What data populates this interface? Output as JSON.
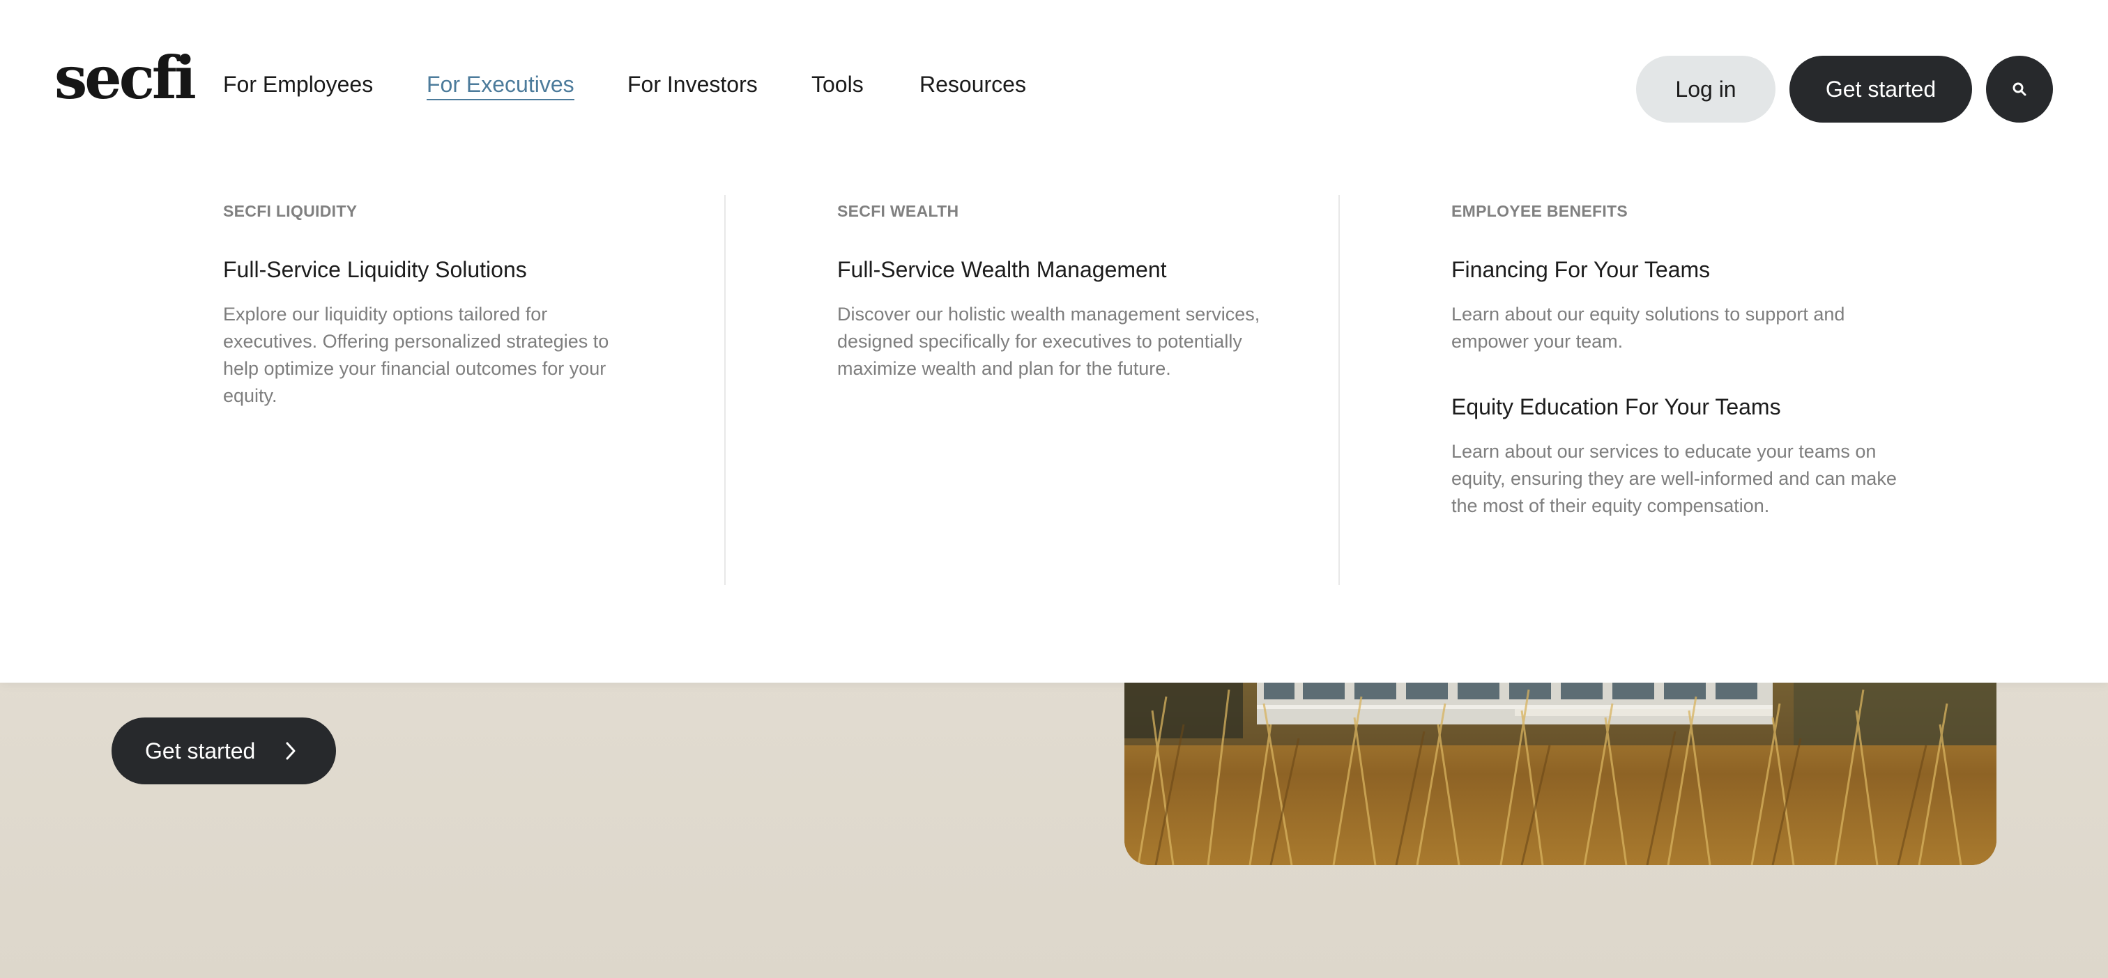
{
  "brand": {
    "logo_text": "secfi"
  },
  "nav": {
    "items": [
      {
        "label": "For Employees",
        "active": false
      },
      {
        "label": "For Executives",
        "active": true
      },
      {
        "label": "For Investors",
        "active": false
      },
      {
        "label": "Tools",
        "active": false
      },
      {
        "label": "Resources",
        "active": false
      }
    ]
  },
  "header_actions": {
    "login_label": "Log in",
    "get_started_label": "Get started",
    "search_icon": "search-icon"
  },
  "mega_menu": {
    "columns": [
      {
        "eyebrow": "SECFI LIQUIDITY",
        "links": [
          {
            "title": "Full-Service Liquidity Solutions",
            "description": "Explore our liquidity options tailored for executives. Offering personalized strategies to help optimize your financial outcomes for your equity."
          }
        ]
      },
      {
        "eyebrow": "SECFI WEALTH",
        "links": [
          {
            "title": "Full-Service Wealth Management",
            "description": "Discover our holistic wealth management services, designed specifically for executives to potentially maximize wealth and plan for the future."
          }
        ]
      },
      {
        "eyebrow": "EMPLOYEE BENEFITS",
        "links": [
          {
            "title": "Financing For Your Teams",
            "description": "Learn about our equity solutions to support and empower your team."
          },
          {
            "title": "Equity Education For Your Teams",
            "description": "Learn about our services to educate your teams on equity, ensuring they are well-informed and can make the most of their equity compensation."
          }
        ]
      }
    ]
  },
  "hero": {
    "cta_label": "Get started",
    "cta_icon": "chevron-right-icon"
  },
  "colors": {
    "accent": "#4c7b9b",
    "dark_button": "#27292c",
    "light_button": "#e3e6e7",
    "page_background": "#e7e2d8"
  }
}
